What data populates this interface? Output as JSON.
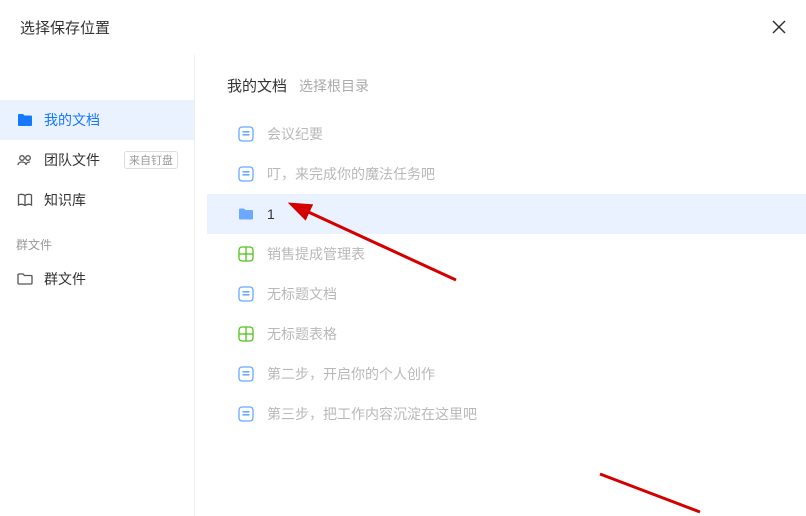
{
  "header": {
    "title": "选择保存位置"
  },
  "sidebar": {
    "items": [
      {
        "label": "我的文档"
      },
      {
        "label": "团队文件",
        "badge": "来自钉盘"
      },
      {
        "label": "知识库"
      }
    ],
    "section_label": "群文件",
    "group_files": {
      "label": "群文件"
    }
  },
  "breadcrumb": {
    "root": "我的文档",
    "sub": "选择根目录"
  },
  "files": [
    {
      "label": "会议纪要",
      "type": "doc"
    },
    {
      "label": "叮，来完成你的魔法任务吧",
      "type": "doc"
    },
    {
      "label": "1",
      "type": "folder"
    },
    {
      "label": "销售提成管理表",
      "type": "sheet"
    },
    {
      "label": "无标题文档",
      "type": "doc"
    },
    {
      "label": "无标题表格",
      "type": "sheet"
    },
    {
      "label": "第二步，开启你的个人创作",
      "type": "doc"
    },
    {
      "label": "第三步，把工作内容沉淀在这里吧",
      "type": "doc"
    }
  ]
}
